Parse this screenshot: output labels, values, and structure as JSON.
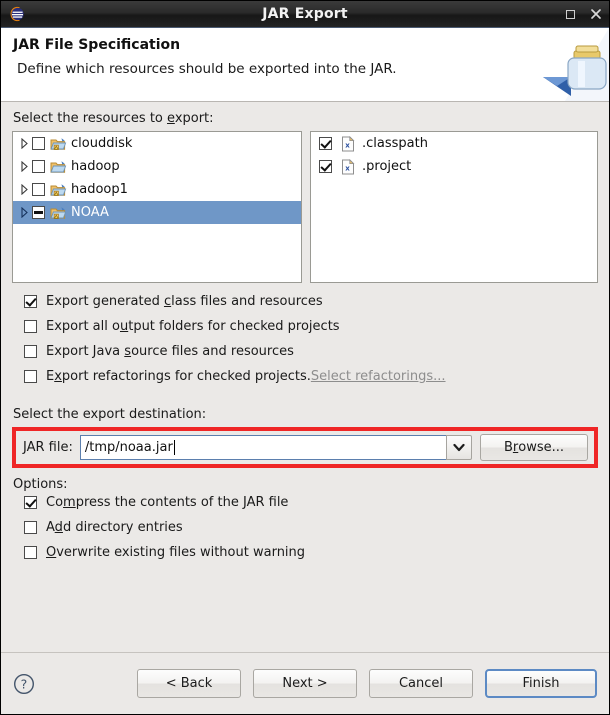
{
  "window": {
    "title": "JAR Export",
    "app_icon": "eclipse-icon",
    "maximize_label": "Maximize",
    "close_label": "Close"
  },
  "header": {
    "title": "JAR File Specification",
    "subtitle": "Define which resources should be exported into the JAR.",
    "art_icon": "jar-banner-icon"
  },
  "resources": {
    "label_pre": "Select the resources to ",
    "label_mnemonic": "e",
    "label_post": "xport:",
    "tree": [
      {
        "name": "clouddisk",
        "checked": false,
        "partial": false,
        "selected": false,
        "expandable": true,
        "icon": "project-folder-warning-icon"
      },
      {
        "name": "hadoop",
        "checked": false,
        "partial": false,
        "selected": false,
        "expandable": true,
        "icon": "project-folder-icon"
      },
      {
        "name": "hadoop1",
        "checked": false,
        "partial": false,
        "selected": false,
        "expandable": true,
        "icon": "project-folder-warning-icon"
      },
      {
        "name": "NOAA",
        "checked": false,
        "partial": true,
        "selected": true,
        "expandable": true,
        "icon": "project-folder-warning-icon"
      }
    ],
    "files": [
      {
        "name": ".classpath",
        "checked": true,
        "icon": "xml-file-icon"
      },
      {
        "name": ".project",
        "checked": true,
        "icon": "xml-file-icon"
      }
    ]
  },
  "export_options": [
    {
      "pre": "Export generated ",
      "mnemonic": "c",
      "post": "lass files and resources",
      "checked": true
    },
    {
      "pre": "Export all o",
      "mnemonic": "u",
      "post": "tput folders for checked projects",
      "checked": false
    },
    {
      "pre": "Export Java ",
      "mnemonic": "s",
      "post": "ource files and resources",
      "checked": false
    },
    {
      "pre": "E",
      "mnemonic": "x",
      "post": "port refactorings for checked projects.",
      "checked": false,
      "link": "Select refactorings...",
      "link_disabled": true
    }
  ],
  "destination": {
    "label": "Select the export destination:",
    "jar_file_label": "JAR file:",
    "jar_file_value": "/tmp/noaa.jar",
    "jar_file_placeholder": "",
    "dropdown_icon": "chevron-down-icon",
    "browse_pre": "B",
    "browse_mnemonic": "r",
    "browse_post": "owse...",
    "highlight_color": "#ef2626"
  },
  "options": {
    "label": "Options:",
    "items": [
      {
        "pre": "Co",
        "mnemonic": "m",
        "post": "press the contents of the JAR file",
        "checked": true
      },
      {
        "pre": "A",
        "mnemonic": "d",
        "post": "d directory entries",
        "checked": false
      },
      {
        "pre": "",
        "mnemonic": "O",
        "post": "verwrite existing files without warning",
        "checked": false
      }
    ]
  },
  "footer": {
    "help_label": "?",
    "buttons": [
      {
        "label": "< Back",
        "primary": false
      },
      {
        "label": "Next >",
        "primary": false
      },
      {
        "label": "Cancel",
        "primary": false
      },
      {
        "label": "Finish",
        "primary": true
      }
    ]
  }
}
